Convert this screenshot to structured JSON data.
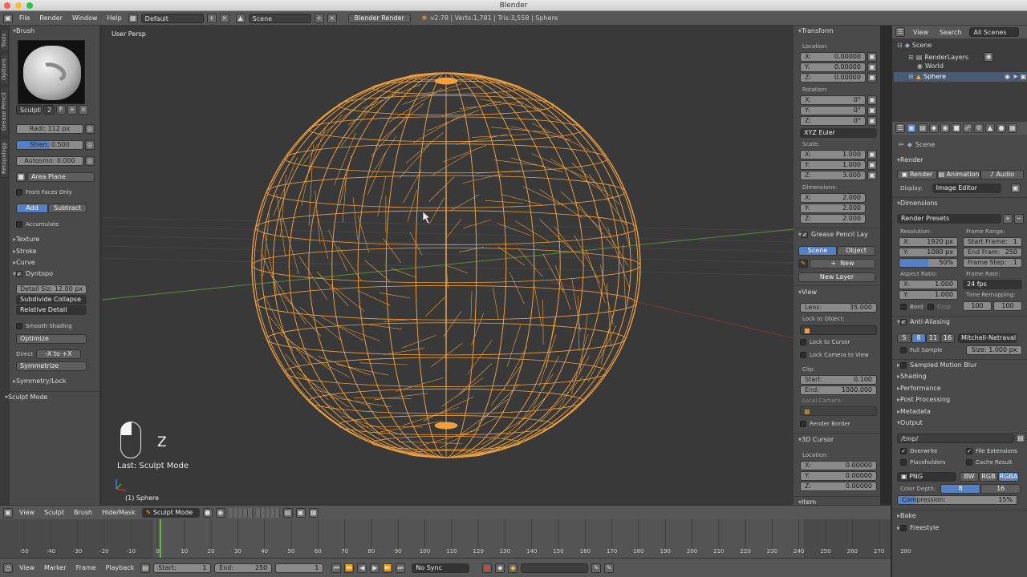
{
  "window": {
    "title": "Blender"
  },
  "topbar": {
    "menus": [
      "File",
      "Render",
      "Window",
      "Help"
    ],
    "layout": "Default",
    "scene": "Scene",
    "engine": "Blender Render",
    "stats": "v2.78 | Verts:1,781 | Tris:3,558 | Sphere"
  },
  "tool_tabs": [
    "Tools",
    "Options",
    "Grease Pencil",
    "Retopology"
  ],
  "tools": {
    "brush_header": "Brush",
    "brush_name": "SculptD",
    "brush_users": "2",
    "brush_fake": "F",
    "radius": "Radi: 112 px",
    "strength_label": "Stren:",
    "strength_value": "0.500",
    "autosmooth": "Autosmo: 0.000",
    "plane": "Area Plane",
    "front_faces": "Front Faces Only",
    "add": "Add",
    "subtract": "Subtract",
    "accumulate": "Accumulate",
    "texture": "Texture",
    "stroke": "Stroke",
    "curve": "Curve",
    "dyntopo": "Dyntopo",
    "detail_size": "Detail Siz: 12.00 px",
    "subdivide": "Subdivide Collapse",
    "relative": "Relative Detail",
    "smooth": "Smooth Shading",
    "optimize": "Optimize",
    "direction_label": "Direct",
    "direction_value": "-X to +X",
    "symmetrize": "Symmetrize",
    "symmetry": "Symmetry/Lock",
    "operator": "Sculpt Mode"
  },
  "viewport": {
    "view_name": "User Persp",
    "key": "Z",
    "last_op": "Last: Sculpt Mode",
    "object": "(1) Sphere",
    "wire_color": "#f0a040"
  },
  "transform": {
    "header": "Transform",
    "location_label": "Location:",
    "location": [
      {
        "axis": "X:",
        "value": "0.00000"
      },
      {
        "axis": "Y:",
        "value": "0.00000"
      },
      {
        "axis": "Z:",
        "value": "0.00000"
      }
    ],
    "rotation_label": "Rotation:",
    "rotation": [
      {
        "axis": "X:",
        "value": "0°"
      },
      {
        "axis": "Y:",
        "value": "0°"
      },
      {
        "axis": "Z:",
        "value": "0°"
      }
    ],
    "rot_mode": "XYZ Euler",
    "scale_label": "Scale:",
    "scale": [
      {
        "axis": "X:",
        "value": "1.000"
      },
      {
        "axis": "Y:",
        "value": "1.000"
      },
      {
        "axis": "Z:",
        "value": "3.000"
      }
    ],
    "dimensions_label": "Dimensions:",
    "dimensions": [
      {
        "axis": "X:",
        "value": "2.000"
      },
      {
        "axis": "Y:",
        "value": "2.000"
      },
      {
        "axis": "Z:",
        "value": "2.000"
      }
    ],
    "gp_header": "Grease Pencil Lay",
    "gp_scene": "Scene",
    "gp_object": "Object",
    "gp_new": "New",
    "gp_new_layer": "New Layer",
    "view_header": "View",
    "lens_label": "Lens:",
    "lens_value": "35.000",
    "lock_object": "Lock to Object:",
    "lock_cursor": "Lock to Cursor",
    "lock_camera": "Lock Camera to View",
    "clip_label": "Clip:",
    "clip_start_label": "Start:",
    "clip_start": "0.100",
    "clip_end_label": "End:",
    "clip_end": "1000.000",
    "local_camera": "Local Camera:",
    "render_border": "Render Border",
    "cursor_header": "3D Cursor",
    "cursor_location_label": "Location:",
    "cursor": [
      {
        "axis": "X:",
        "value": "0.00000"
      },
      {
        "axis": "Y:",
        "value": "0.00000"
      },
      {
        "axis": "Z:",
        "value": "0.00000"
      }
    ],
    "item_header": "Item"
  },
  "outliner": {
    "view": "View",
    "search": "Search",
    "all_scenes": "All Scenes",
    "items": [
      "Scene",
      "RenderLayers",
      "World",
      "Sphere"
    ]
  },
  "properties": {
    "breadcrumb": "Scene",
    "render_header": "Render",
    "render_btn": "Render",
    "animation_btn": "Animation",
    "audio_btn": "Audio",
    "display_label": "Display:",
    "display_value": "Image Editor",
    "dimensions_header": "Dimensions",
    "presets": "Render Presets",
    "resolution_label": "Resolution:",
    "res_x": "1920 px",
    "res_y": "1080 px",
    "res_pct": "50%",
    "frame_range_label": "Frame Range:",
    "start_frame_label": "Start Frame:",
    "start_frame": "1",
    "end_frame_label": "End Fram:",
    "end_frame": "250",
    "frame_step_label": "Frame Step:",
    "frame_step": "1",
    "aspect_label": "Aspect Ratio:",
    "aspect_x": "1.000",
    "aspect_y": "1.000",
    "frame_rate_label": "Frame Rate:",
    "fps": "24 fps",
    "bord": "Bord",
    "crop": "Crop",
    "time_remap_label": "Time Remapping:",
    "remap_old": "100",
    "remap_new": "100",
    "aa_header": "Anti-Aliasing",
    "aa_samples": [
      "5",
      "8",
      "11",
      "16"
    ],
    "aa_filter": "Mitchell-Netravali",
    "full_sample": "Full Sample",
    "size": "Size: 1.000 px",
    "motion_blur": "Sampled Motion Blur",
    "shading": "Shading",
    "performance": "Performance",
    "post": "Post Processing",
    "metadata": "Metadata",
    "output_header": "Output",
    "output_path": "/tmp/",
    "overwrite": "Overwrite",
    "file_ext": "File Extensions",
    "placeholders": "Placeholders",
    "cache": "Cache Result",
    "format": "PNG",
    "bw": "BW",
    "rgb": "RGB",
    "rgba": "RGBA",
    "color_depth_label": "Color Depth:",
    "depth_8": "8",
    "depth_16": "16",
    "compression_label": "Compression:",
    "compression_value": "15%",
    "bake": "Bake",
    "freestyle": "Freestyle"
  },
  "header3d": {
    "menus": [
      "View",
      "Sculpt",
      "Brush",
      "Hide/Mask"
    ],
    "mode": "Sculpt Mode"
  },
  "timeline": {
    "ticks": [
      "-50",
      "-40",
      "-30",
      "-20",
      "-10",
      "0",
      "10",
      "20",
      "30",
      "40",
      "50",
      "60",
      "70",
      "80",
      "90",
      "100",
      "110",
      "120",
      "130",
      "140",
      "150",
      "160",
      "170",
      "180",
      "190",
      "200",
      "210",
      "220",
      "230",
      "240",
      "250",
      "260",
      "270",
      "280"
    ],
    "current_frame": 1,
    "menus": [
      "View",
      "Marker",
      "Frame",
      "Playback"
    ],
    "start_label": "Start:",
    "start": "1",
    "end_label": "End:",
    "end": "250",
    "current": "1",
    "sync": "No Sync"
  }
}
